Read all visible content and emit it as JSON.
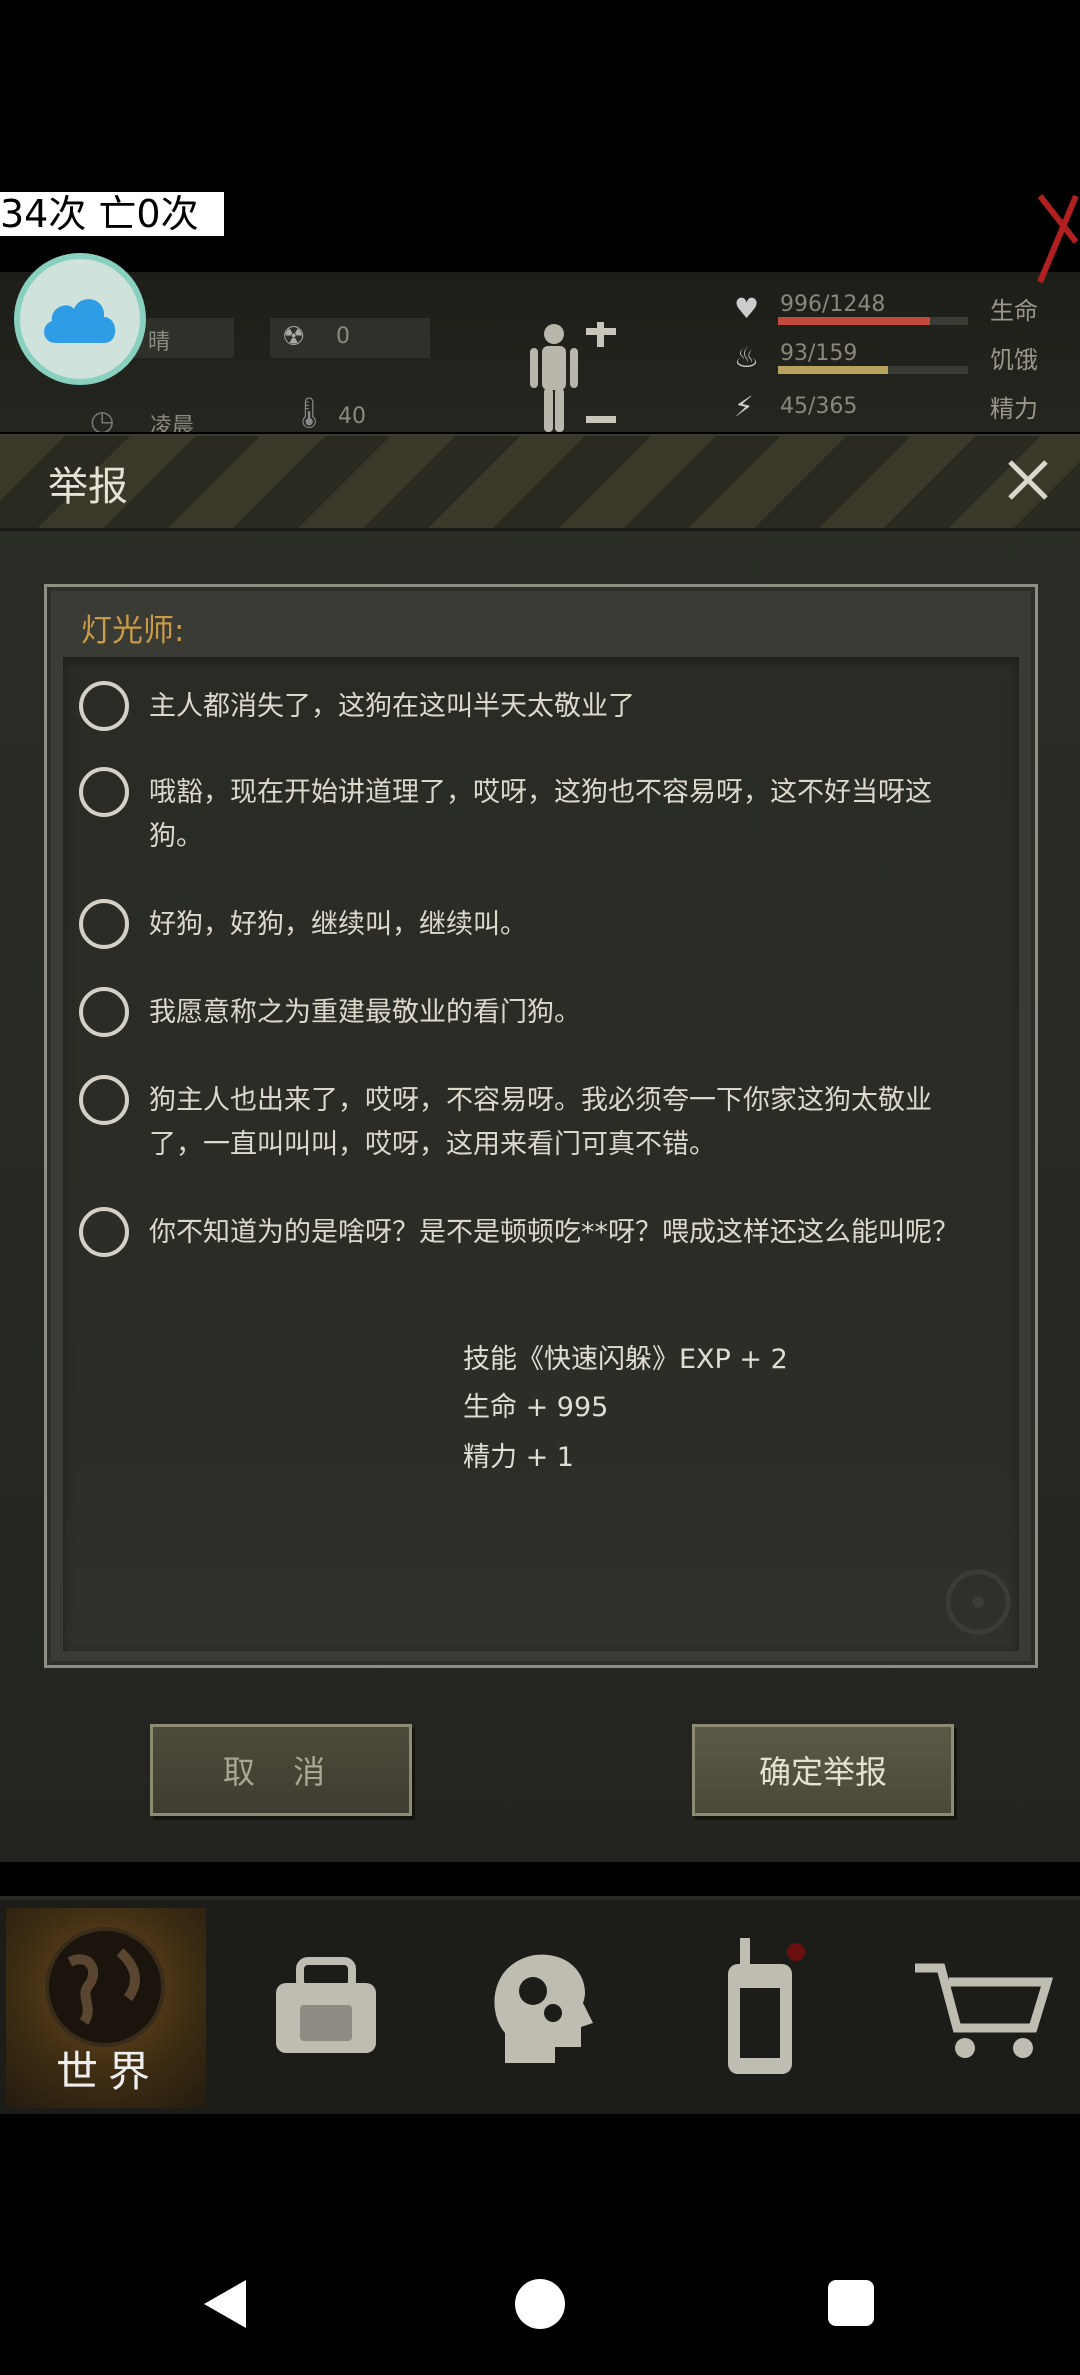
{
  "counter": {
    "text": "34次 亡0次"
  },
  "hud": {
    "weather": "晴",
    "radiation": "0",
    "time_label": "凌晨",
    "temperature": "40",
    "stats": [
      {
        "value": "996/1248",
        "label": "生命",
        "fraction": 0.8,
        "color": "#c24a3a"
      },
      {
        "value": "93/159",
        "label": "饥饿",
        "fraction": 0.58,
        "color": "#b9a35c"
      },
      {
        "value": "45/365",
        "label": "精力",
        "fraction": 0.12,
        "color": "#6a9a6a"
      }
    ]
  },
  "modal": {
    "title": "举报",
    "subtitle": "灯光师:",
    "options": [
      "主人都消失了，这狗在这叫半天太敬业了",
      "哦豁，现在开始讲道理了，哎呀，这狗也不容易呀，这不好当呀这狗。",
      "好狗，好狗，继续叫，继续叫。",
      "我愿意称之为重建最敬业的看门狗。",
      "狗主人也出来了，哎呀，不容易呀。我必须夸一下你家这狗太敬业了，一直叫叫叫，哎呀，这用来看门可真不错。",
      "你不知道为的是啥呀？是不是顿顿吃**呀？喂成这样还这么能叫呢？"
    ],
    "rewards": [
      "技能《快速闪躲》EXP + 2",
      "生命 + 995",
      "精力 + 1"
    ],
    "cancel_label": "取 消",
    "confirm_label": "确定举报"
  },
  "bottom_nav": {
    "world_label": "世界"
  }
}
